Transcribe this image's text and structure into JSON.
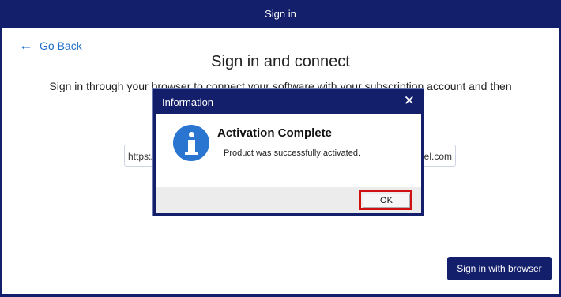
{
  "window": {
    "title": "Sign in"
  },
  "page": {
    "back_label": "Go Back",
    "back_icon": "arrow-left-icon",
    "title": "Sign in and connect",
    "description": "Sign in through your browser to connect your software with your subscription account and then",
    "url_prefix": "https:/",
    "url_suffix": "bel.com",
    "sign_in_button": "Sign in with browser"
  },
  "dialog": {
    "title": "Information",
    "close_icon": "close-icon",
    "icon": "info-icon",
    "heading": "Activation Complete",
    "message": "Product was successfully activated.",
    "ok_label": "OK"
  },
  "colors": {
    "accent": "#141f6b",
    "link": "#1e6fc9",
    "info_icon": "#2a75d0",
    "highlight": "#d11111"
  }
}
